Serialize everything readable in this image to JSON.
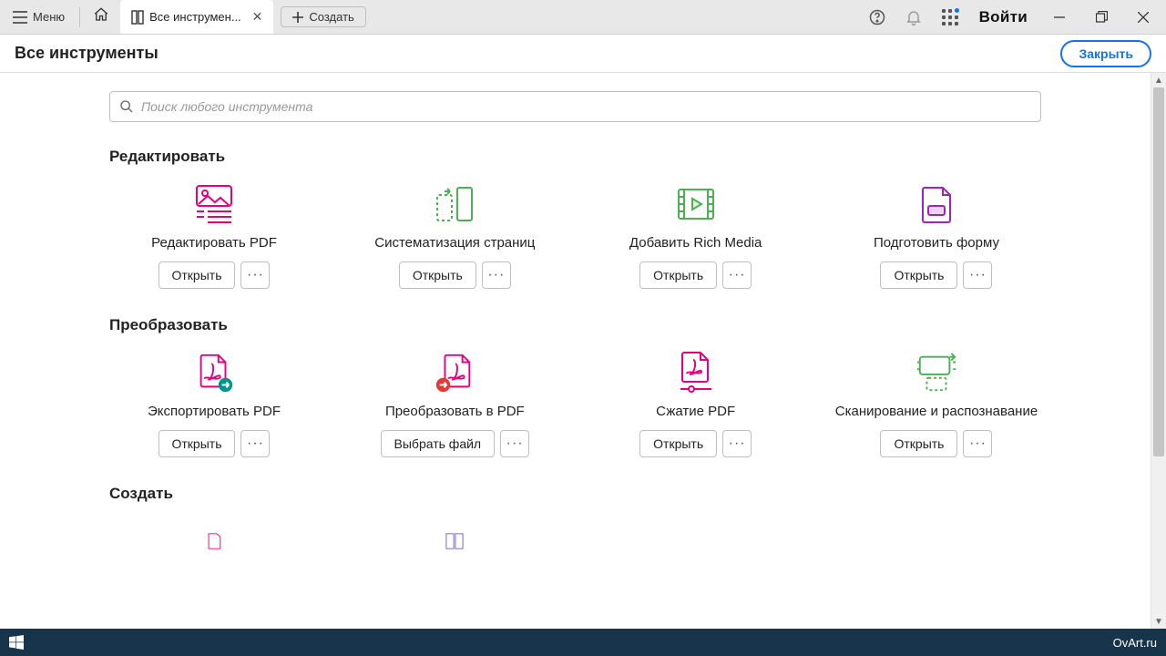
{
  "titlebar": {
    "menu_label": "Меню",
    "tab_title": "Все инструмен...",
    "create_label": "Создать",
    "signin_label": "Войти"
  },
  "subheader": {
    "title": "Все инструменты",
    "close_label": "Закрыть"
  },
  "search": {
    "placeholder": "Поиск любого инструмента"
  },
  "common": {
    "open_label": "Открыть",
    "choose_file_label": "Выбрать файл",
    "more_label": "···"
  },
  "sections": {
    "edit": {
      "title": "Редактировать",
      "tools": [
        {
          "label": "Редактировать PDF"
        },
        {
          "label": "Систематизация страниц"
        },
        {
          "label": "Добавить Rich Media"
        },
        {
          "label": "Подготовить форму"
        }
      ]
    },
    "convert": {
      "title": "Преобразовать",
      "tools": [
        {
          "label": "Экспортировать PDF"
        },
        {
          "label": "Преобразовать в PDF"
        },
        {
          "label": "Сжатие PDF"
        },
        {
          "label": "Сканирование и распознавание"
        }
      ]
    },
    "create": {
      "title": "Создать"
    }
  },
  "taskbar": {
    "brand": "OvArt.ru"
  }
}
